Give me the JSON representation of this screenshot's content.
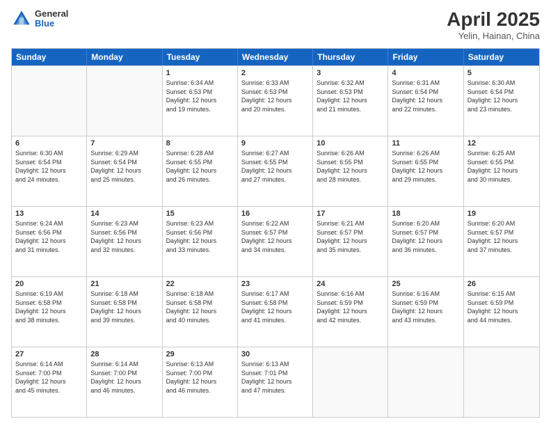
{
  "header": {
    "logo": {
      "line1": "General",
      "line2": "Blue"
    },
    "title": "April 2025",
    "subtitle": "Yelin, Hainan, China"
  },
  "weekdays": [
    "Sunday",
    "Monday",
    "Tuesday",
    "Wednesday",
    "Thursday",
    "Friday",
    "Saturday"
  ],
  "weeks": [
    [
      {
        "day": "",
        "empty": true
      },
      {
        "day": "",
        "empty": true
      },
      {
        "day": "1",
        "sunrise": "6:34 AM",
        "sunset": "6:53 PM",
        "daylight": "12 hours and 19 minutes."
      },
      {
        "day": "2",
        "sunrise": "6:33 AM",
        "sunset": "6:53 PM",
        "daylight": "12 hours and 20 minutes."
      },
      {
        "day": "3",
        "sunrise": "6:32 AM",
        "sunset": "6:53 PM",
        "daylight": "12 hours and 21 minutes."
      },
      {
        "day": "4",
        "sunrise": "6:31 AM",
        "sunset": "6:54 PM",
        "daylight": "12 hours and 22 minutes."
      },
      {
        "day": "5",
        "sunrise": "6:30 AM",
        "sunset": "6:54 PM",
        "daylight": "12 hours and 23 minutes."
      }
    ],
    [
      {
        "day": "6",
        "sunrise": "6:30 AM",
        "sunset": "6:54 PM",
        "daylight": "12 hours and 24 minutes."
      },
      {
        "day": "7",
        "sunrise": "6:29 AM",
        "sunset": "6:54 PM",
        "daylight": "12 hours and 25 minutes."
      },
      {
        "day": "8",
        "sunrise": "6:28 AM",
        "sunset": "6:55 PM",
        "daylight": "12 hours and 26 minutes."
      },
      {
        "day": "9",
        "sunrise": "6:27 AM",
        "sunset": "6:55 PM",
        "daylight": "12 hours and 27 minutes."
      },
      {
        "day": "10",
        "sunrise": "6:26 AM",
        "sunset": "6:55 PM",
        "daylight": "12 hours and 28 minutes."
      },
      {
        "day": "11",
        "sunrise": "6:26 AM",
        "sunset": "6:55 PM",
        "daylight": "12 hours and 29 minutes."
      },
      {
        "day": "12",
        "sunrise": "6:25 AM",
        "sunset": "6:55 PM",
        "daylight": "12 hours and 30 minutes."
      }
    ],
    [
      {
        "day": "13",
        "sunrise": "6:24 AM",
        "sunset": "6:56 PM",
        "daylight": "12 hours and 31 minutes."
      },
      {
        "day": "14",
        "sunrise": "6:23 AM",
        "sunset": "6:56 PM",
        "daylight": "12 hours and 32 minutes."
      },
      {
        "day": "15",
        "sunrise": "6:23 AM",
        "sunset": "6:56 PM",
        "daylight": "12 hours and 33 minutes."
      },
      {
        "day": "16",
        "sunrise": "6:22 AM",
        "sunset": "6:57 PM",
        "daylight": "12 hours and 34 minutes."
      },
      {
        "day": "17",
        "sunrise": "6:21 AM",
        "sunset": "6:57 PM",
        "daylight": "12 hours and 35 minutes."
      },
      {
        "day": "18",
        "sunrise": "6:20 AM",
        "sunset": "6:57 PM",
        "daylight": "12 hours and 36 minutes."
      },
      {
        "day": "19",
        "sunrise": "6:20 AM",
        "sunset": "6:57 PM",
        "daylight": "12 hours and 37 minutes."
      }
    ],
    [
      {
        "day": "20",
        "sunrise": "6:19 AM",
        "sunset": "6:58 PM",
        "daylight": "12 hours and 38 minutes."
      },
      {
        "day": "21",
        "sunrise": "6:18 AM",
        "sunset": "6:58 PM",
        "daylight": "12 hours and 39 minutes."
      },
      {
        "day": "22",
        "sunrise": "6:18 AM",
        "sunset": "6:58 PM",
        "daylight": "12 hours and 40 minutes."
      },
      {
        "day": "23",
        "sunrise": "6:17 AM",
        "sunset": "6:58 PM",
        "daylight": "12 hours and 41 minutes."
      },
      {
        "day": "24",
        "sunrise": "6:16 AM",
        "sunset": "6:59 PM",
        "daylight": "12 hours and 42 minutes."
      },
      {
        "day": "25",
        "sunrise": "6:16 AM",
        "sunset": "6:59 PM",
        "daylight": "12 hours and 43 minutes."
      },
      {
        "day": "26",
        "sunrise": "6:15 AM",
        "sunset": "6:59 PM",
        "daylight": "12 hours and 44 minutes."
      }
    ],
    [
      {
        "day": "27",
        "sunrise": "6:14 AM",
        "sunset": "7:00 PM",
        "daylight": "12 hours and 45 minutes."
      },
      {
        "day": "28",
        "sunrise": "6:14 AM",
        "sunset": "7:00 PM",
        "daylight": "12 hours and 46 minutes."
      },
      {
        "day": "29",
        "sunrise": "6:13 AM",
        "sunset": "7:00 PM",
        "daylight": "12 hours and 46 minutes."
      },
      {
        "day": "30",
        "sunrise": "6:13 AM",
        "sunset": "7:01 PM",
        "daylight": "12 hours and 47 minutes."
      },
      {
        "day": "",
        "empty": true
      },
      {
        "day": "",
        "empty": true
      },
      {
        "day": "",
        "empty": true
      }
    ]
  ],
  "labels": {
    "sunrise_prefix": "Sunrise: ",
    "sunset_prefix": "Sunset: ",
    "daylight_prefix": "Daylight: "
  }
}
